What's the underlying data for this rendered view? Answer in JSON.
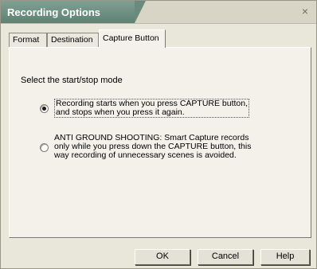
{
  "window": {
    "title": "Recording Options",
    "close_glyph": "×"
  },
  "tabs": [
    {
      "label": "Format",
      "active": false
    },
    {
      "label": "Destination",
      "active": false
    },
    {
      "label": "Capture Button",
      "active": true
    }
  ],
  "panel": {
    "mode_label": "Select the start/stop mode",
    "options": [
      {
        "line1": "Recording starts when you press CAPTURE button,",
        "line2": "and stops when you press it again.",
        "checked": true
      },
      {
        "line1": "ANTI GROUND SHOOTING: Smart Capture records",
        "line2": "only while you press down the CAPTURE button, this",
        "line3": "way recording of unnecessary scenes is avoided.",
        "checked": false
      }
    ]
  },
  "buttons": {
    "ok": "OK",
    "cancel": "Cancel",
    "help": "Help"
  }
}
